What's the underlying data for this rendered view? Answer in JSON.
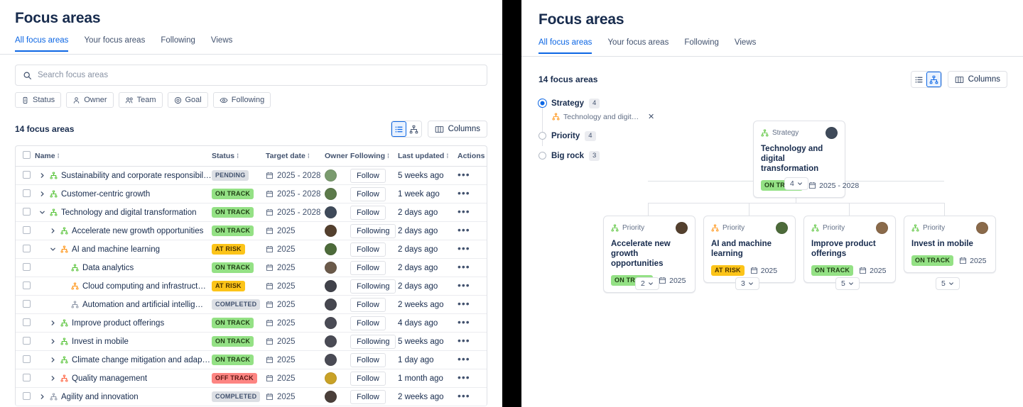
{
  "left": {
    "title": "Focus areas",
    "tabs": [
      {
        "label": "All focus areas",
        "active": true
      },
      {
        "label": "Your focus areas",
        "active": false
      },
      {
        "label": "Following",
        "active": false
      },
      {
        "label": "Views",
        "active": false
      }
    ],
    "search": {
      "value": "",
      "placeholder": "Search focus areas"
    },
    "filter_chips": [
      {
        "label": "Status",
        "icon": "status-icon"
      },
      {
        "label": "Owner",
        "icon": "person-icon"
      },
      {
        "label": "Team",
        "icon": "people-icon"
      },
      {
        "label": "Goal",
        "icon": "target-icon"
      },
      {
        "label": "Following",
        "icon": "eye-icon"
      }
    ],
    "count_label": "14 focus areas",
    "view_toggle": {
      "list_active": true,
      "tree_active": false
    },
    "columns_button": "Columns",
    "table": {
      "headers": [
        "Name",
        "Status",
        "Target date",
        "Owner",
        "Following",
        "Last updated",
        "Actions"
      ],
      "rows": [
        {
          "indent": 0,
          "chevron": "right",
          "tree_color": "#4bbf2a",
          "name": "Sustainability and corporate responsibil…",
          "status": "PENDING",
          "status_class": "b-pending",
          "date": "2025 - 2028",
          "avatar": "#7a9b6e",
          "follow": "Follow",
          "updated": "5 weeks ago"
        },
        {
          "indent": 0,
          "chevron": "right",
          "tree_color": "#4bbf2a",
          "name": "Customer-centric growth",
          "status": "ON TRACK",
          "status_class": "b-ontrack",
          "date": "2025 - 2028",
          "avatar": "#5c7a4a",
          "follow": "Follow",
          "updated": "1 week ago"
        },
        {
          "indent": 0,
          "chevron": "down",
          "tree_color": "#4bbf2a",
          "name": "Technology and digital transformation",
          "status": "ON TRACK",
          "status_class": "b-ontrack",
          "date": "2025 - 2028",
          "avatar": "#3f4a5a",
          "follow": "Follow",
          "updated": "2 days ago"
        },
        {
          "indent": 1,
          "chevron": "right",
          "tree_color": "#4bbf2a",
          "name": "Accelerate new growth opportunities",
          "status": "ON TRACK",
          "status_class": "b-ontrack",
          "date": "2025",
          "avatar": "#54402e",
          "follow": "Following",
          "updated": "2 days ago"
        },
        {
          "indent": 1,
          "chevron": "down",
          "tree_color": "#ff8b00",
          "name": "AI and machine learning",
          "status": "AT RISK",
          "status_class": "b-atrisk",
          "date": "2025",
          "avatar": "#4d6b3a",
          "follow": "Follow",
          "updated": "2 days ago"
        },
        {
          "indent": 2,
          "chevron": "none",
          "tree_color": "#4bbf2a",
          "name": "Data analytics",
          "status": "ON TRACK",
          "status_class": "b-ontrack",
          "date": "2025",
          "avatar": "#6b5a4a",
          "follow": "Follow",
          "updated": "2 days ago"
        },
        {
          "indent": 2,
          "chevron": "none",
          "tree_color": "#ff8b00",
          "name": "Cloud computing and infrastruct…",
          "status": "AT RISK",
          "status_class": "b-atrisk",
          "date": "2025",
          "avatar": "#41424a",
          "follow": "Following",
          "updated": "2 days ago"
        },
        {
          "indent": 2,
          "chevron": "none",
          "tree_color": "#8993a4",
          "name": "Automation and artificial intellig…",
          "status": "COMPLETED",
          "status_class": "b-completed",
          "date": "2025",
          "avatar": "#46474f",
          "follow": "Follow",
          "updated": "2 weeks ago"
        },
        {
          "indent": 1,
          "chevron": "right",
          "tree_color": "#4bbf2a",
          "name": "Improve product offerings",
          "status": "ON TRACK",
          "status_class": "b-ontrack",
          "date": "2025",
          "avatar": "#4a4b55",
          "follow": "Follow",
          "updated": "4 days ago"
        },
        {
          "indent": 1,
          "chevron": "right",
          "tree_color": "#4bbf2a",
          "name": "Invest in mobile",
          "status": "ON TRACK",
          "status_class": "b-ontrack",
          "date": "2025",
          "avatar": "#4a4b55",
          "follow": "Following",
          "updated": "5 weeks ago"
        },
        {
          "indent": 1,
          "chevron": "right",
          "tree_color": "#4bbf2a",
          "name": "Climate change mitigation and adap…",
          "status": "ON TRACK",
          "status_class": "b-ontrack",
          "date": "2025",
          "avatar": "#4a4b55",
          "follow": "Follow",
          "updated": "1 day ago"
        },
        {
          "indent": 1,
          "chevron": "right",
          "tree_color": "#ff5630",
          "name": "Quality management",
          "status": "OFF TRACK",
          "status_class": "b-offtrack",
          "date": "2025",
          "avatar": "#c9a227",
          "follow": "Follow",
          "updated": "1 month ago"
        },
        {
          "indent": 0,
          "chevron": "right",
          "tree_color": "#8993a4",
          "name": "Agility and innovation",
          "status": "COMPLETED",
          "status_class": "b-completed",
          "date": "2025",
          "avatar": "#4a3f3a",
          "follow": "Follow",
          "updated": "2 weeks ago"
        }
      ]
    }
  },
  "right": {
    "title": "Focus areas",
    "tabs": [
      {
        "label": "All focus areas",
        "active": true
      },
      {
        "label": "Your focus areas",
        "active": false
      },
      {
        "label": "Following",
        "active": false
      },
      {
        "label": "Views",
        "active": false
      }
    ],
    "count_label": "14 focus areas",
    "view_toggle": {
      "list_active": false,
      "tree_active": true
    },
    "columns_button": "Columns",
    "level_filters": [
      {
        "label": "Strategy",
        "count": "4",
        "selected": true,
        "chip": "Technology and digital tra…"
      },
      {
        "label": "Priority",
        "count": "4",
        "selected": false,
        "chip": null
      },
      {
        "label": "Big rock",
        "count": "3",
        "selected": false,
        "chip": null
      }
    ],
    "tree": {
      "root": {
        "type": "Strategy",
        "type_color": "#4bbf2a",
        "title": "Technology and digital transformation",
        "status": "ON TRACK",
        "status_class": "b-ontrack",
        "date": "2025 - 2028",
        "avatar": "#3f4a5a",
        "expand_count": "4"
      },
      "children": [
        {
          "type": "Priority",
          "type_color": "#4bbf2a",
          "title": "Accelerate new growth opportunities",
          "status": "ON TRACK",
          "status_class": "b-ontrack",
          "date": "2025",
          "avatar": "#54402e",
          "expand_count": "2"
        },
        {
          "type": "Priority",
          "type_color": "#ff8b00",
          "title": "AI and machine learning",
          "status": "AT RISK",
          "status_class": "b-atrisk",
          "date": "2025",
          "avatar": "#4d6b3a",
          "expand_count": "3"
        },
        {
          "type": "Priority",
          "type_color": "#4bbf2a",
          "title": "Improve product offerings",
          "status": "ON TRACK",
          "status_class": "b-ontrack",
          "date": "2025",
          "avatar": "#8a6a4a",
          "expand_count": "5"
        },
        {
          "type": "Priority",
          "type_color": "#4bbf2a",
          "title": "Invest in mobile",
          "status": "ON TRACK",
          "status_class": "b-ontrack",
          "date": "2025",
          "avatar": "#8a6a4a",
          "expand_count": "5"
        }
      ]
    }
  },
  "colors": {
    "accent": "#0c66e4",
    "border": "#dfe1e6",
    "text": "#172b4d",
    "subtle_text": "#42526e",
    "on_track": "#94e185",
    "at_risk": "#fcc419",
    "off_track": "#fd8582",
    "neutral": "#dcdfe4"
  }
}
